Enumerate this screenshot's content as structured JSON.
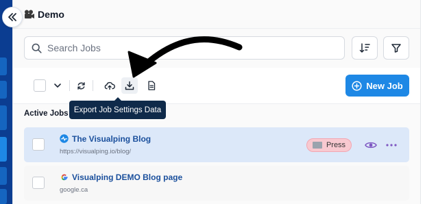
{
  "header": {
    "title": "Demo"
  },
  "search": {
    "placeholder": "Search Jobs"
  },
  "toolbar": {
    "new_job_label": "New Job"
  },
  "tooltip": {
    "text": "Export Job Settings Data"
  },
  "section": {
    "label": "Active Jobs (4)"
  },
  "jobs": [
    {
      "title": "The Visualping Blog",
      "url": "https://visualping.io/blog/",
      "badge": "Press"
    },
    {
      "title": "Visualping DEMO Blog page",
      "url": "google.ca"
    }
  ],
  "colors": {
    "accent": "#1e88e5",
    "nav_dark": "#0b3d91",
    "selected_row": "#dce8f9",
    "badge_bg": "#f8c9d0",
    "tooltip_bg": "#0f2a4a",
    "link_title": "#1a4f9c",
    "action_purple": "#7e57c2"
  },
  "icons": {
    "collapse": "double-chevron-left-icon",
    "logo": "movie-camera-icon",
    "search": "search-icon",
    "sort": "sort-icon",
    "filter": "filter-icon",
    "dropdown": "chevron-down-icon",
    "refresh": "refresh-icon",
    "upload": "cloud-upload-icon",
    "export": "download-icon",
    "document": "document-icon",
    "add": "plus-circle-icon",
    "eye": "eye-icon",
    "more": "more-dots-icon",
    "annotation": "arrow-annotation"
  }
}
